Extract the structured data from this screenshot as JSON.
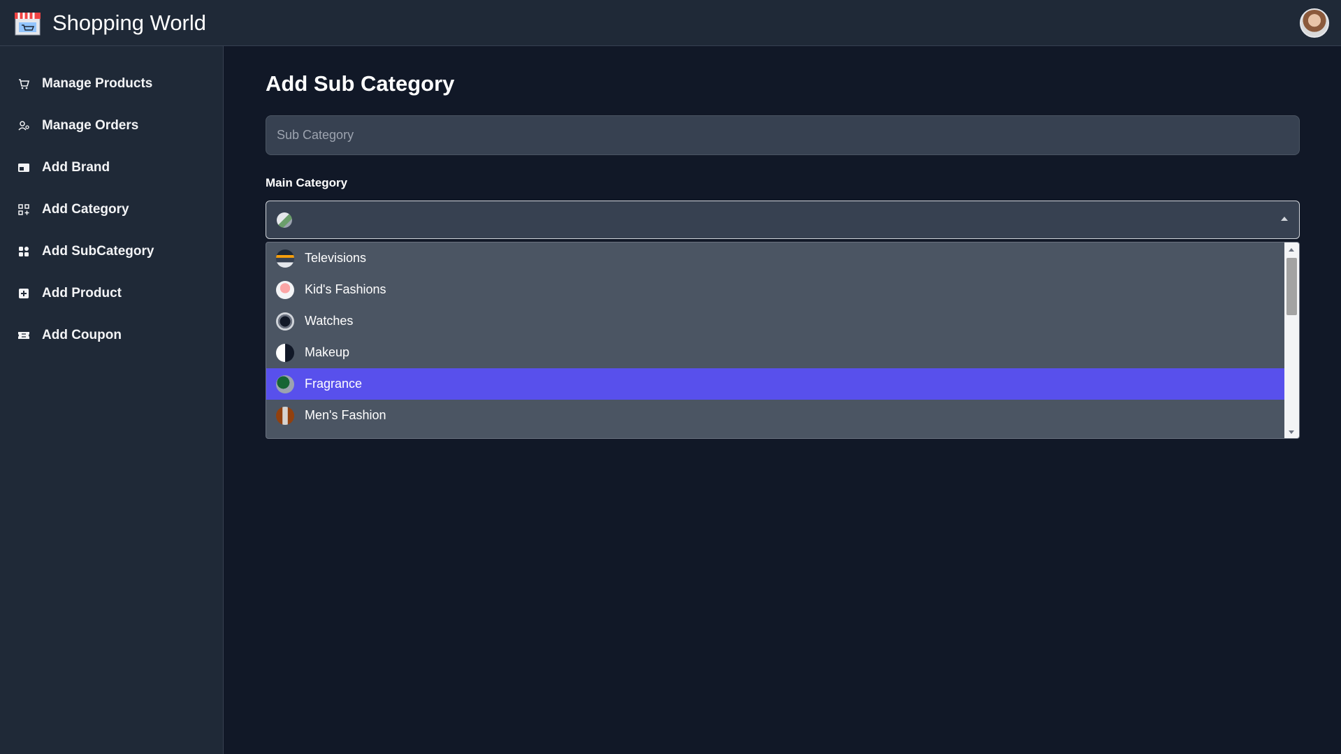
{
  "app": {
    "title": "Shopping World"
  },
  "sidebar": {
    "items": [
      {
        "label": "Manage Products",
        "icon": "cart-icon"
      },
      {
        "label": "Manage Orders",
        "icon": "users-icon"
      },
      {
        "label": "Add Brand",
        "icon": "card-icon"
      },
      {
        "label": "Add Category",
        "icon": "grid-outline-icon"
      },
      {
        "label": "Add SubCategory",
        "icon": "grid-filled-icon"
      },
      {
        "label": "Add Product",
        "icon": "plus-square-icon"
      },
      {
        "label": "Add Coupon",
        "icon": "ticket-icon"
      }
    ]
  },
  "main": {
    "page_title": "Add Sub Category",
    "sub_category_placeholder": "Sub Category",
    "main_category_label": "Main Category",
    "dropdown": {
      "options": [
        {
          "label": "Televisions"
        },
        {
          "label": "Kid's Fashions"
        },
        {
          "label": "Watches"
        },
        {
          "label": "Makeup"
        },
        {
          "label": "Fragrance"
        },
        {
          "label": "Men's Fashion"
        }
      ],
      "highlighted": "Fragrance"
    }
  },
  "colors": {
    "background": "#111827",
    "panel": "#1f2937",
    "input": "#374151",
    "dropdown": "#4b5563",
    "highlight": "#5850ec"
  }
}
